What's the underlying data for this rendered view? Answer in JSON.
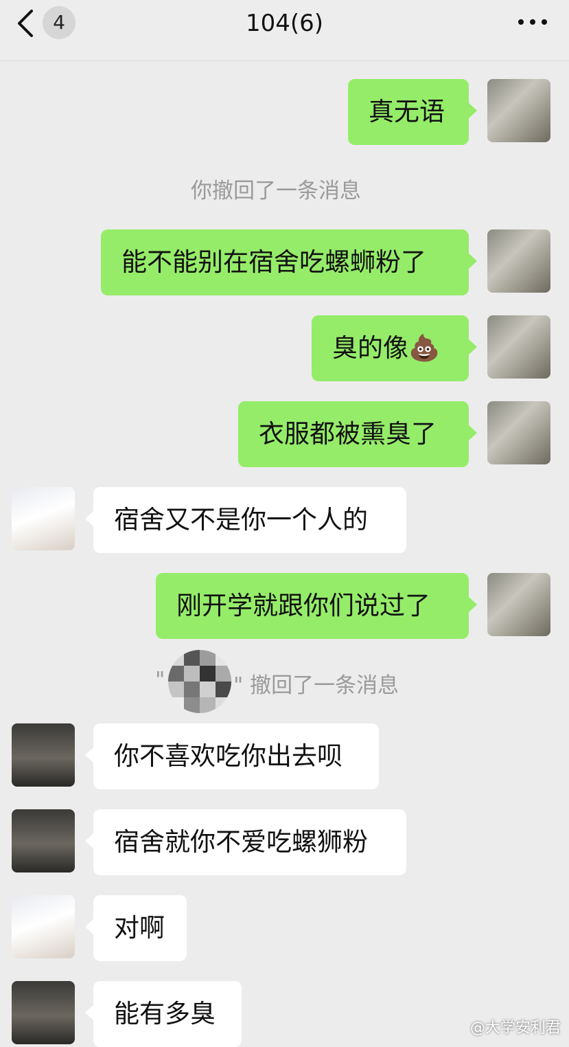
{
  "header": {
    "unread_count": "4",
    "title": "104(6)",
    "back_icon": "chevron-left-icon",
    "more_icon": "ellipsis-icon"
  },
  "messages": {
    "m1": "真无语",
    "sys1": "你撤回了一条消息",
    "m2": "能不能别在宿舍吃螺蛳粉了",
    "m3_text": "臭的像",
    "m3_emoji": "💩",
    "m4": "衣服都被熏臭了",
    "m5": "宿舍又不是你一个人的",
    "m6": "刚开学就跟你们说过了",
    "sys2_open": "\"",
    "sys2_close": "\" 撤回了一条消息",
    "m7": "你不喜欢吃你出去呗",
    "m8": "宿舍就你不爱吃螺狮粉",
    "m9": "对啊",
    "m10": "能有多臭"
  },
  "watermark": "@大学安利君",
  "colors": {
    "self_bubble": "#95ec69",
    "other_bubble": "#ffffff",
    "background": "#ececec"
  }
}
